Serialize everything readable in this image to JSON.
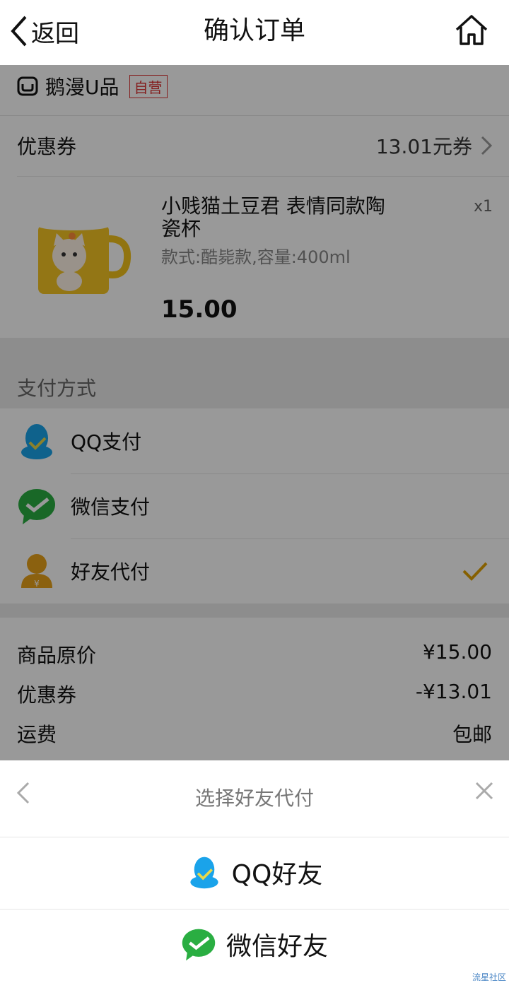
{
  "header": {
    "back_label": "返回",
    "title": "确认订单"
  },
  "shop": {
    "name": "鹅漫U品",
    "badge": "自营"
  },
  "coupon": {
    "label": "优惠券",
    "value": "13.01元券"
  },
  "product": {
    "name": "小贱猫土豆君 表情同款陶瓷杯",
    "quantity": "x1",
    "variant": "款式:酷毙款,容量:400ml",
    "price": "15.00"
  },
  "payment": {
    "section_title": "支付方式",
    "options": [
      {
        "label": "QQ支付",
        "icon": "qq-penguin-icon"
      },
      {
        "label": "微信支付",
        "icon": "wechat-icon"
      },
      {
        "label": "好友代付",
        "icon": "friend-pay-icon",
        "selected": true
      }
    ]
  },
  "summary": {
    "items": [
      {
        "label": "商品原价",
        "value": "¥15.00"
      },
      {
        "label": "优惠券",
        "value": "-¥13.01"
      },
      {
        "label": "运费",
        "value": "包邮"
      }
    ]
  },
  "sheet": {
    "title": "选择好友代付",
    "options": [
      {
        "label": "QQ好友",
        "icon": "qq-penguin-icon"
      },
      {
        "label": "微信好友",
        "icon": "wechat-icon"
      }
    ]
  },
  "watermark": "流星社区",
  "colors": {
    "accent": "#e0a000",
    "qq_blue": "#1aa3ea",
    "wechat_green": "#2aae42",
    "badge_red": "#dd3333"
  }
}
